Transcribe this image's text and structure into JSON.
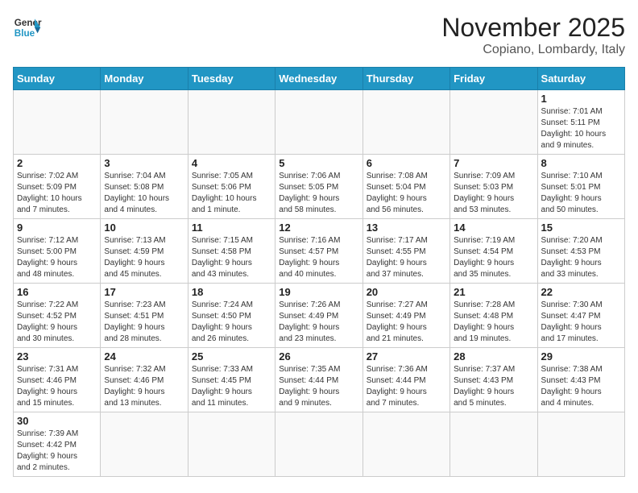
{
  "header": {
    "logo_line1": "General",
    "logo_line2": "Blue",
    "title": "November 2025",
    "subtitle": "Copiano, Lombardy, Italy"
  },
  "weekdays": [
    "Sunday",
    "Monday",
    "Tuesday",
    "Wednesday",
    "Thursday",
    "Friday",
    "Saturday"
  ],
  "weeks": [
    [
      {
        "day": "",
        "info": ""
      },
      {
        "day": "",
        "info": ""
      },
      {
        "day": "",
        "info": ""
      },
      {
        "day": "",
        "info": ""
      },
      {
        "day": "",
        "info": ""
      },
      {
        "day": "",
        "info": ""
      },
      {
        "day": "1",
        "info": "Sunrise: 7:01 AM\nSunset: 5:11 PM\nDaylight: 10 hours\nand 9 minutes."
      }
    ],
    [
      {
        "day": "2",
        "info": "Sunrise: 7:02 AM\nSunset: 5:09 PM\nDaylight: 10 hours\nand 7 minutes."
      },
      {
        "day": "3",
        "info": "Sunrise: 7:04 AM\nSunset: 5:08 PM\nDaylight: 10 hours\nand 4 minutes."
      },
      {
        "day": "4",
        "info": "Sunrise: 7:05 AM\nSunset: 5:06 PM\nDaylight: 10 hours\nand 1 minute."
      },
      {
        "day": "5",
        "info": "Sunrise: 7:06 AM\nSunset: 5:05 PM\nDaylight: 9 hours\nand 58 minutes."
      },
      {
        "day": "6",
        "info": "Sunrise: 7:08 AM\nSunset: 5:04 PM\nDaylight: 9 hours\nand 56 minutes."
      },
      {
        "day": "7",
        "info": "Sunrise: 7:09 AM\nSunset: 5:03 PM\nDaylight: 9 hours\nand 53 minutes."
      },
      {
        "day": "8",
        "info": "Sunrise: 7:10 AM\nSunset: 5:01 PM\nDaylight: 9 hours\nand 50 minutes."
      }
    ],
    [
      {
        "day": "9",
        "info": "Sunrise: 7:12 AM\nSunset: 5:00 PM\nDaylight: 9 hours\nand 48 minutes."
      },
      {
        "day": "10",
        "info": "Sunrise: 7:13 AM\nSunset: 4:59 PM\nDaylight: 9 hours\nand 45 minutes."
      },
      {
        "day": "11",
        "info": "Sunrise: 7:15 AM\nSunset: 4:58 PM\nDaylight: 9 hours\nand 43 minutes."
      },
      {
        "day": "12",
        "info": "Sunrise: 7:16 AM\nSunset: 4:57 PM\nDaylight: 9 hours\nand 40 minutes."
      },
      {
        "day": "13",
        "info": "Sunrise: 7:17 AM\nSunset: 4:55 PM\nDaylight: 9 hours\nand 37 minutes."
      },
      {
        "day": "14",
        "info": "Sunrise: 7:19 AM\nSunset: 4:54 PM\nDaylight: 9 hours\nand 35 minutes."
      },
      {
        "day": "15",
        "info": "Sunrise: 7:20 AM\nSunset: 4:53 PM\nDaylight: 9 hours\nand 33 minutes."
      }
    ],
    [
      {
        "day": "16",
        "info": "Sunrise: 7:22 AM\nSunset: 4:52 PM\nDaylight: 9 hours\nand 30 minutes."
      },
      {
        "day": "17",
        "info": "Sunrise: 7:23 AM\nSunset: 4:51 PM\nDaylight: 9 hours\nand 28 minutes."
      },
      {
        "day": "18",
        "info": "Sunrise: 7:24 AM\nSunset: 4:50 PM\nDaylight: 9 hours\nand 26 minutes."
      },
      {
        "day": "19",
        "info": "Sunrise: 7:26 AM\nSunset: 4:49 PM\nDaylight: 9 hours\nand 23 minutes."
      },
      {
        "day": "20",
        "info": "Sunrise: 7:27 AM\nSunset: 4:49 PM\nDaylight: 9 hours\nand 21 minutes."
      },
      {
        "day": "21",
        "info": "Sunrise: 7:28 AM\nSunset: 4:48 PM\nDaylight: 9 hours\nand 19 minutes."
      },
      {
        "day": "22",
        "info": "Sunrise: 7:30 AM\nSunset: 4:47 PM\nDaylight: 9 hours\nand 17 minutes."
      }
    ],
    [
      {
        "day": "23",
        "info": "Sunrise: 7:31 AM\nSunset: 4:46 PM\nDaylight: 9 hours\nand 15 minutes."
      },
      {
        "day": "24",
        "info": "Sunrise: 7:32 AM\nSunset: 4:46 PM\nDaylight: 9 hours\nand 13 minutes."
      },
      {
        "day": "25",
        "info": "Sunrise: 7:33 AM\nSunset: 4:45 PM\nDaylight: 9 hours\nand 11 minutes."
      },
      {
        "day": "26",
        "info": "Sunrise: 7:35 AM\nSunset: 4:44 PM\nDaylight: 9 hours\nand 9 minutes."
      },
      {
        "day": "27",
        "info": "Sunrise: 7:36 AM\nSunset: 4:44 PM\nDaylight: 9 hours\nand 7 minutes."
      },
      {
        "day": "28",
        "info": "Sunrise: 7:37 AM\nSunset: 4:43 PM\nDaylight: 9 hours\nand 5 minutes."
      },
      {
        "day": "29",
        "info": "Sunrise: 7:38 AM\nSunset: 4:43 PM\nDaylight: 9 hours\nand 4 minutes."
      }
    ],
    [
      {
        "day": "30",
        "info": "Sunrise: 7:39 AM\nSunset: 4:42 PM\nDaylight: 9 hours\nand 2 minutes."
      },
      {
        "day": "",
        "info": ""
      },
      {
        "day": "",
        "info": ""
      },
      {
        "day": "",
        "info": ""
      },
      {
        "day": "",
        "info": ""
      },
      {
        "day": "",
        "info": ""
      },
      {
        "day": "",
        "info": ""
      }
    ]
  ]
}
